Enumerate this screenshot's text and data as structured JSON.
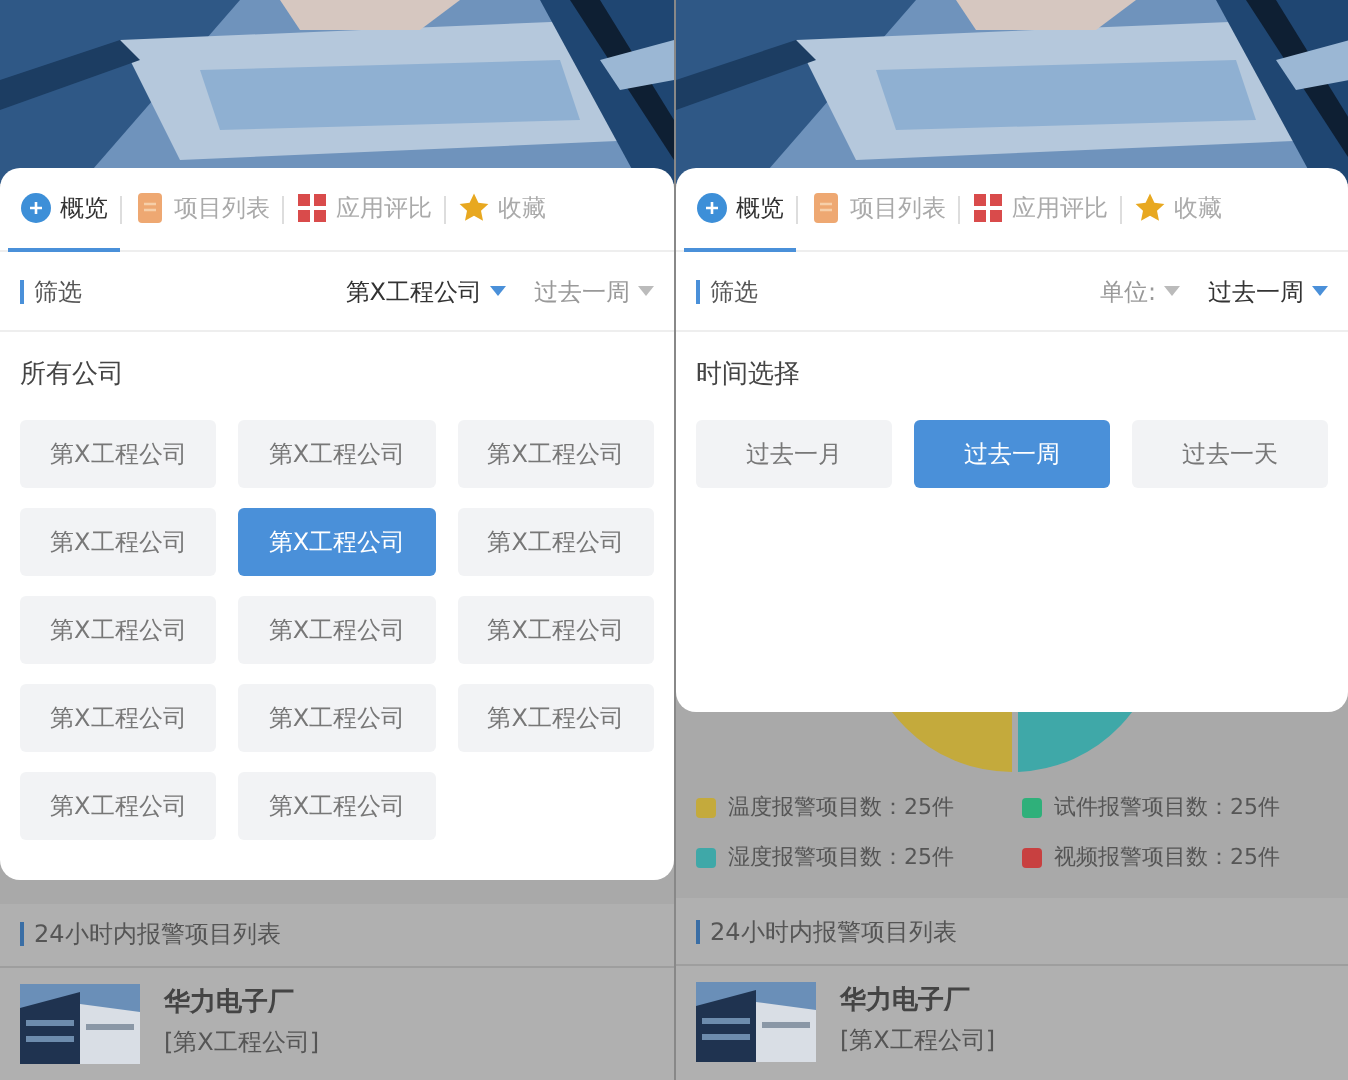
{
  "screens": [
    {
      "tabs": [
        {
          "label": "概览",
          "kind": "overview",
          "selected": true
        },
        {
          "label": "项目列表",
          "kind": "list",
          "selected": false
        },
        {
          "label": "应用评比",
          "kind": "grid",
          "selected": false
        },
        {
          "label": "收藏",
          "kind": "star",
          "selected": false
        }
      ],
      "filter": {
        "label": "筛选",
        "dropdowns": [
          {
            "label": "第X工程公司",
            "active": true
          },
          {
            "label": "过去一周",
            "active": false
          }
        ]
      },
      "popup": {
        "title": "所有公司",
        "options": [
          {
            "label": "第X工程公司",
            "selected": false
          },
          {
            "label": "第X工程公司",
            "selected": false
          },
          {
            "label": "第X工程公司",
            "selected": false
          },
          {
            "label": "第X工程公司",
            "selected": false
          },
          {
            "label": "第X工程公司",
            "selected": true
          },
          {
            "label": "第X工程公司",
            "selected": false
          },
          {
            "label": "第X工程公司",
            "selected": false
          },
          {
            "label": "第X工程公司",
            "selected": false
          },
          {
            "label": "第X工程公司",
            "selected": false
          },
          {
            "label": "第X工程公司",
            "selected": false
          },
          {
            "label": "第X工程公司",
            "selected": false
          },
          {
            "label": "第X工程公司",
            "selected": false
          },
          {
            "label": "第X工程公司",
            "selected": false
          },
          {
            "label": "第X工程公司",
            "selected": false
          }
        ]
      },
      "section_title": "24小时内报警项目列表",
      "list": [
        {
          "name": "华力电子厂",
          "company": "[第X工程公司]"
        }
      ]
    },
    {
      "tabs": [
        {
          "label": "概览",
          "kind": "overview",
          "selected": true
        },
        {
          "label": "项目列表",
          "kind": "list",
          "selected": false
        },
        {
          "label": "应用评比",
          "kind": "grid",
          "selected": false
        },
        {
          "label": "收藏",
          "kind": "star",
          "selected": false
        }
      ],
      "filter": {
        "label": "筛选",
        "dropdowns": [
          {
            "label": "单位:",
            "active": false
          },
          {
            "label": "过去一周",
            "active": true
          }
        ]
      },
      "popup": {
        "title": "时间选择",
        "options": [
          {
            "label": "过去一月",
            "selected": false
          },
          {
            "label": "过去一周",
            "selected": true
          },
          {
            "label": "过去一天",
            "selected": false
          }
        ]
      },
      "legend": [
        {
          "text": "温度报警项目数：25件",
          "color": "#c4aa3c"
        },
        {
          "text": "试件报警项目数：25件",
          "color": "#2fb07a"
        },
        {
          "text": "湿度报警项目数：25件",
          "color": "#3fa8a8"
        },
        {
          "text": "视频报警项目数：25件",
          "color": "#c84040"
        }
      ],
      "section_title": "24小时内报警项目列表",
      "list": [
        {
          "name": "华力电子厂",
          "company": "[第X工程公司]"
        }
      ]
    }
  ]
}
